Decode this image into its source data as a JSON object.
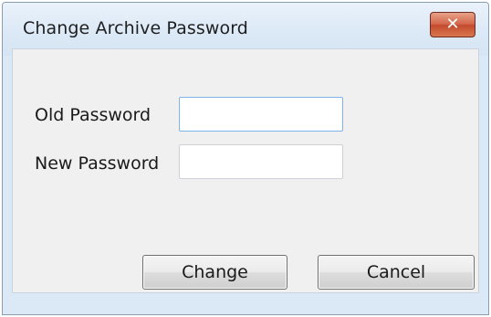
{
  "window": {
    "title": "Change Archive Password",
    "close_icon": "close-icon"
  },
  "form": {
    "old_password_label": "Old Password",
    "old_password_value": "",
    "new_password_label": "New Password",
    "new_password_value": ""
  },
  "buttons": {
    "change_label": "Change",
    "cancel_label": "Cancel"
  },
  "colors": {
    "titlebar": "#dce9f6",
    "client": "#f0f0f0",
    "close_button": "#c34a2e",
    "focus_border": "#7eb4ea"
  }
}
